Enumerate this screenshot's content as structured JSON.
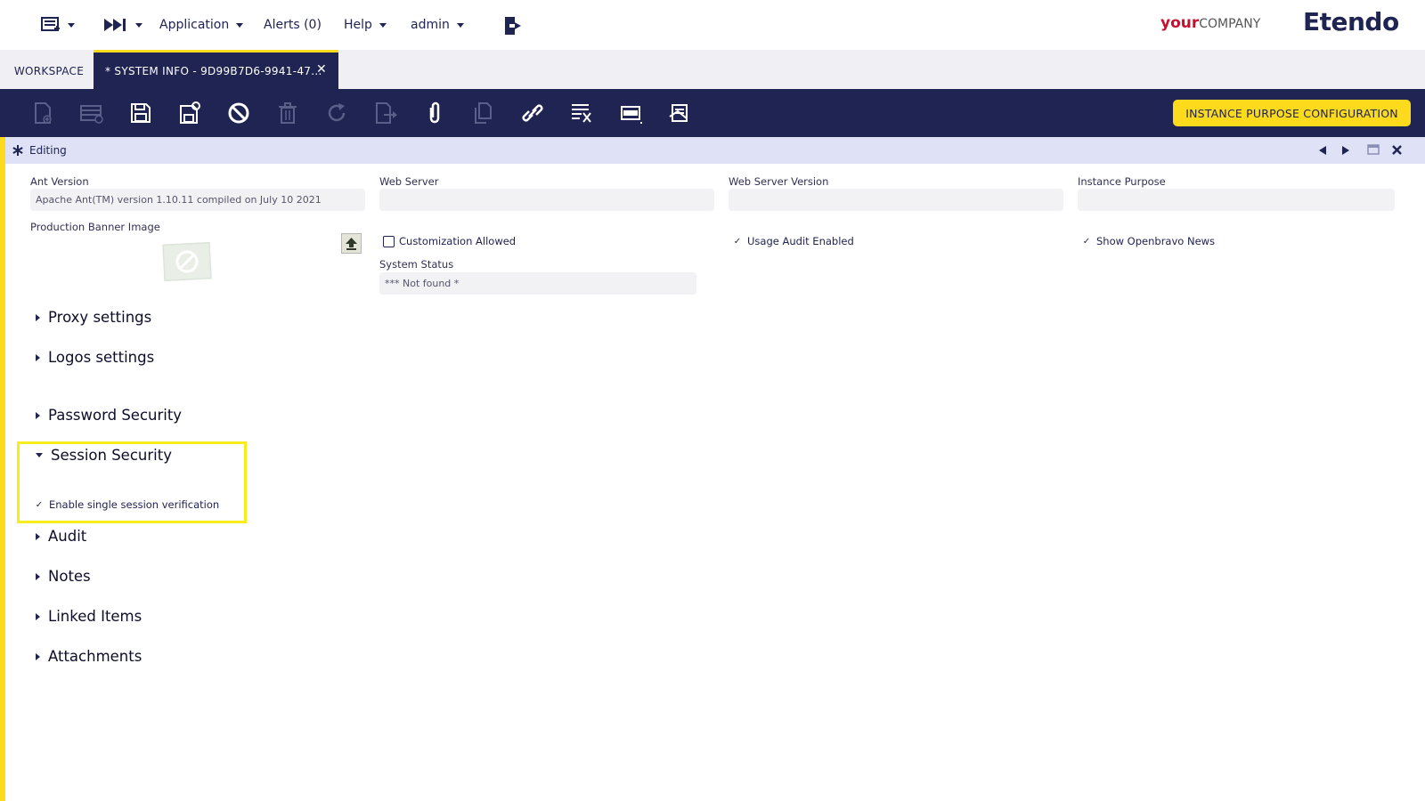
{
  "menu": {
    "application_label": "Application",
    "alerts_label": "Alerts (0)",
    "help_label": "Help",
    "user_label": "admin"
  },
  "brand": {
    "your_label": "your",
    "company_label": "COMPANY",
    "etendo_label": "Etendo"
  },
  "tabs": {
    "workspace_label": "WORKSPACE",
    "active_label": "* SYSTEM INFO - 9D99B7D6-9941-47...",
    "close_glyph": "✕"
  },
  "toolbar": {
    "purpose_button_label": "INSTANCE PURPOSE CONFIGURATION",
    "icons": [
      "new-document-icon",
      "new-row-icon",
      "save-icon",
      "save-close-icon",
      "undo-icon",
      "delete-icon",
      "refresh-icon",
      "export-icon",
      "attachment-icon",
      "clone-icon",
      "link-icon",
      "audit-icon",
      "toggle-view-icon",
      "tree-icon"
    ]
  },
  "status": {
    "text": "Editing"
  },
  "form": {
    "ant_version_label": "Ant Version",
    "ant_version_value": "Apache Ant(TM) version 1.10.11 compiled on July 10 2021",
    "web_server_label": "Web Server",
    "web_server_value": "",
    "web_server_version_label": "Web Server Version",
    "web_server_version_value": "",
    "instance_purpose_label": "Instance Purpose",
    "instance_purpose_value": "",
    "production_banner_label": "Production Banner Image",
    "customization_allowed_label": "Customization Allowed",
    "usage_audit_label": "Usage Audit Enabled",
    "show_news_label": "Show Openbravo News",
    "system_status_label": "System Status",
    "system_status_value": "*** Not found *"
  },
  "sections": {
    "proxy": "Proxy settings",
    "logos": "Logos settings",
    "password": "Password Security",
    "session": "Session Security",
    "single_session_label": "Enable single session verification",
    "audit": "Audit",
    "notes": "Notes",
    "linked_items": "Linked Items",
    "attachments": "Attachments"
  },
  "colors": {
    "navy": "#202452",
    "accent_yellow": "#fdda1b",
    "status_bar": "#dfe2f7",
    "brand_red": "#c8102e"
  }
}
